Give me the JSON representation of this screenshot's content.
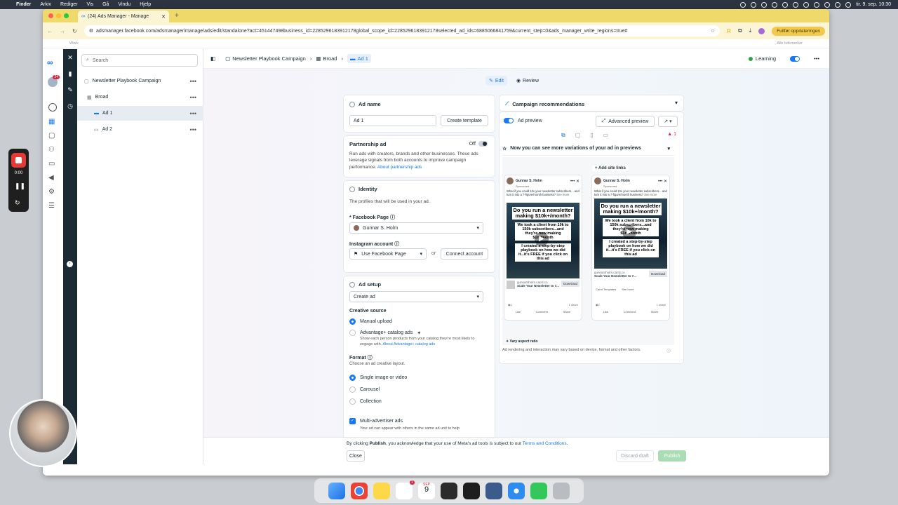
{
  "macmenu": {
    "apple": "",
    "items": [
      "Finder",
      "Arkiv",
      "Rediger",
      "Vis",
      "Gå",
      "Vindu",
      "Hjelp"
    ],
    "clock": "tir. 9. sep. 10:30"
  },
  "browser": {
    "tab_title": "(24) Ads Manager - Manage",
    "url": "adsmanager.facebook.com/adsmanager/manage/ads/edit/standalone?act=451447498business_id=2285296183912178global_scope_id=2285296183912178selected_ad_ids=6885066841759&current_step=0&ads_manager_write_regions=true#",
    "update_button": "Fullfør oppdateringen",
    "bookmark_left": "Work",
    "bookmark_right": "Alle bokmerker"
  },
  "leftnav": {
    "badge": "24",
    "badge2": "1"
  },
  "tree": {
    "search_placeholder": "Search",
    "items": [
      {
        "label": "Newsletter Playbook Campaign"
      },
      {
        "label": "Broad"
      },
      {
        "label": "Ad 1"
      },
      {
        "label": "Ad 2"
      }
    ]
  },
  "breadcrumb": {
    "campaign": "Newsletter Playbook Campaign",
    "adset": "Broad",
    "ad": "Ad 1",
    "status": "Learning"
  },
  "modes": {
    "edit": "Edit",
    "review": "Review"
  },
  "adname": {
    "title": "Ad name",
    "value": "Ad 1",
    "create_template": "Create template"
  },
  "partnership": {
    "title": "Partnership ad",
    "state": "Off",
    "desc": "Run ads with creators, brands and other businesses. These ads leverage signals from both accounts to improve campaign performance.",
    "link": "About partnership ads"
  },
  "identity": {
    "title": "Identity",
    "desc": "The profiles that will be used in your ad.",
    "fb_label": "* Facebook Page",
    "fb_value": "Gunnar S. Holm",
    "ig_label": "Instagram account",
    "ig_value": "Use Facebook Page",
    "or": "or",
    "connect": "Connect account"
  },
  "adsetup": {
    "title": "Ad setup",
    "create_value": "Create ad",
    "source_label": "Creative source",
    "manual": "Manual upload",
    "catalog": "Advantage+ catalog ads",
    "catalog_desc": "Show each person products from your catalog they're most likely to engage with.",
    "catalog_link": "About Advantage+ catalog ads",
    "format_label": "Format",
    "format_desc": "Choose an ad creative layout.",
    "single": "Single image or video",
    "carousel": "Carousel",
    "collection": "Collection",
    "multi": "Multi-advertiser ads",
    "multi_desc": "Your ad can appear with others in the same ad unit to help"
  },
  "preview": {
    "recommendations": "Campaign recommendations",
    "ad_preview": "Ad preview",
    "advanced": "Advanced preview",
    "warn_count": "1",
    "variations": "Now you can see more variations of your ad in previews",
    "add_site_links": "Add site links",
    "page_name": "Gunnar S. Holm",
    "sponsored": "Sponsored",
    "post_text": "What if you could 10x your newsletter subscribers... and turn it into a 7-figure/month business?",
    "see_more": "See more",
    "headline": "Do you run a newsletter making $10k+/month?",
    "sub1": "We took a client from 10k to 150k subscribers...and they're now making $1m/month",
    "sub2": "I created a step-by-step playbook on how we did it...it's FREE if you click on this ad",
    "domain": "gunnarsholm.carrd.co",
    "cta_title": "Scale Your Newsletter to 7...",
    "cta_button": "Download",
    "reactions": "2",
    "shares": "1 share",
    "like": "Like",
    "comment": "Comment",
    "share": "Share",
    "site_link1": "Carrd Templates",
    "site_link2": "See more",
    "vary": "Vary aspect ratio",
    "disclaimer": "Ad rendering and interaction may vary based on device, format and other factors."
  },
  "footer": {
    "terms_prefix": "By clicking ",
    "terms_bold": "Publish",
    "terms_mid": ", you acknowledge that your use of Meta's ad tools is subject to our ",
    "terms_link": "Terms and Conditions",
    "terms_end": ".",
    "close": "Close",
    "discard": "Discard draft",
    "publish": "Publish"
  },
  "recorder": {
    "time": "0:00"
  },
  "dock": {
    "date_month": "SEP",
    "date_day": "9",
    "slack_badge": "1"
  },
  "colors": {
    "accent": "#1877f2",
    "tabstrip": "#f0d96b",
    "nav": "#1c2b33",
    "learning": "#31a24c"
  }
}
